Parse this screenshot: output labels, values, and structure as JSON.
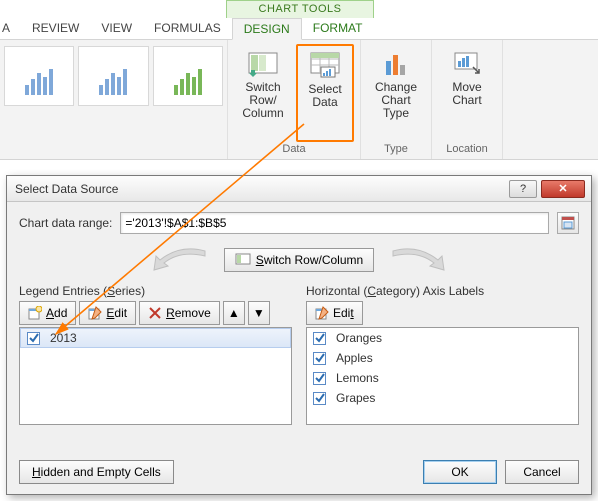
{
  "ribbon": {
    "tools_tab": "CHART TOOLS",
    "tabs": {
      "a": "A",
      "review": "REVIEW",
      "view": "VIEW",
      "formulas": "FORMULAS",
      "design": "DESIGN",
      "format": "FORMAT"
    },
    "groups": {
      "data": {
        "switch_label": "Switch Row/\nColumn",
        "select_label": "Select\nData",
        "label": "Data"
      },
      "type": {
        "change_label": "Change\nChart Type",
        "label": "Type"
      },
      "location": {
        "move_label": "Move\nChart",
        "label": "Location"
      }
    }
  },
  "dialog": {
    "title": "Select Data Source",
    "range_label": "Chart data range:",
    "range_value": "='2013'!$A$1:$B$5",
    "switch_btn": "Switch Row/Column",
    "legend_title_pre": "Legend Entries (",
    "legend_title_u": "S",
    "legend_title_post": "eries)",
    "axis_title_pre": "Horizontal (",
    "axis_title_u": "C",
    "axis_title_post": "ategory) Axis Labels",
    "buttons": {
      "add": "Add",
      "edit": "Edit",
      "remove": "Remove",
      "edit_axis": "Edit"
    },
    "series": [
      {
        "name": "2013"
      }
    ],
    "categories": [
      "Oranges",
      "Apples",
      "Lemons",
      "Grapes"
    ],
    "footer": {
      "hidden": "Hidden and Empty Cells",
      "ok": "OK",
      "cancel": "Cancel"
    }
  },
  "colors": {
    "highlight": "#ff7a00",
    "excel_green": "#2b7a1a"
  }
}
